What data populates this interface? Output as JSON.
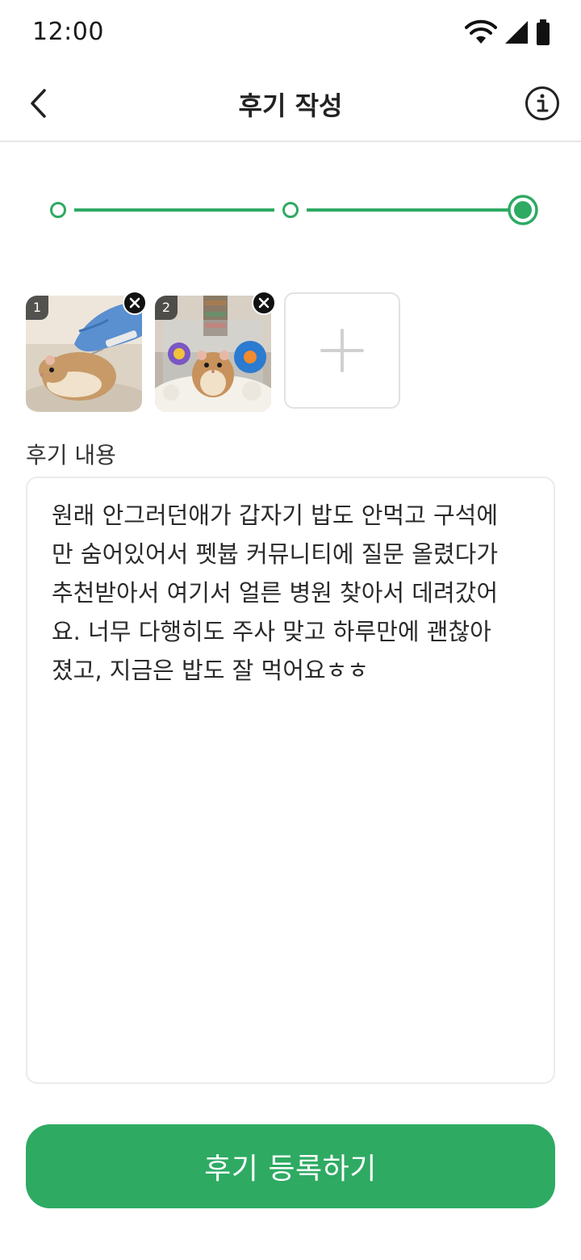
{
  "status_bar": {
    "time": "12:00",
    "icons": [
      "wifi-icon",
      "cellular-signal-icon",
      "battery-icon"
    ]
  },
  "header": {
    "back_icon": "chevron-left-icon",
    "title": "후기 작성",
    "info_icon": "info-icon"
  },
  "stepper": {
    "total_steps": 3,
    "current_step": 3
  },
  "photos": [
    {
      "index": "1",
      "subject": "hamster-injection-photo",
      "remove_icon": "close-icon"
    },
    {
      "index": "2",
      "subject": "hamster-cage-photo",
      "remove_icon": "close-icon"
    }
  ],
  "add_photo": {
    "icon": "plus-icon"
  },
  "review": {
    "label": "후기 내용",
    "text": "원래 안그러던애가 갑자기 밥도 안먹고 구석에\n만 숨어있어서 펫븁 커뮤니티에 질문 올렸다가\n추천받아서 여기서 얼른 병원 찾아서 데려갔어\n요. 너무 다행히도 주사 맞고 하루만에 괜찮아\n졌고, 지금은 밥도 잘 먹어요ㅎㅎ"
  },
  "submit": {
    "label": "후기 등록하기"
  },
  "colors": {
    "accent": "#2eaa63",
    "text": "#222222",
    "border": "#ebebeb"
  }
}
